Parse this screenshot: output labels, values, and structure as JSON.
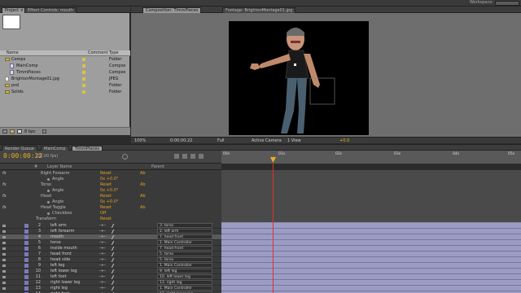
{
  "topbar": {
    "workspace_label": "Workspace:"
  },
  "project_panel": {
    "tabs": [
      "Project ×",
      "Effect Controls: mouth"
    ],
    "columns": {
      "name": "Name",
      "comment": "Comment",
      "type": "Type"
    },
    "items": [
      {
        "name": "Comps",
        "type": "Folder",
        "icon": "folder-icon"
      },
      {
        "name": "MainComp",
        "type": "Compos",
        "icon": "composition-icon"
      },
      {
        "name": "TimmPieces",
        "type": "Compos",
        "icon": "composition-icon"
      },
      {
        "name": "BrightonMontage01.jpg",
        "type": "JPEG",
        "icon": "image-icon"
      },
      {
        "name": "psd",
        "type": "Folder",
        "icon": "folder-icon"
      },
      {
        "name": "Solids",
        "type": "Folder",
        "icon": "folder-icon"
      }
    ],
    "bpc": "8 bpc"
  },
  "viewer": {
    "tabs": [
      "Composition: TimmPieces",
      "Footage: BrightonMontage01.jpg"
    ],
    "bar": {
      "zoom": "100%",
      "timecode": "0:00:00:22",
      "resolution": "Full",
      "camera": "Active Camera",
      "views": "1 View",
      "exposure": "+0.0"
    }
  },
  "timeline": {
    "tabs": [
      "Render Queue",
      "MainComp",
      "TimmPieces"
    ],
    "timecode": "0:00:00:22",
    "fps": "(25.00 fps)",
    "ruler_ticks": [
      "00s",
      "01s",
      "02s",
      "03s",
      "04s",
      "05s"
    ],
    "columns": {
      "layer_name": "Layer Name",
      "parent": "Parent"
    },
    "properties": [
      {
        "label": "Right Forearm",
        "v1": "Reset",
        "v2": "Ab",
        "fx": true
      },
      {
        "label": "Angle",
        "v1": "0x +0.0°",
        "v2": "",
        "fx": false
      },
      {
        "label": "Torso",
        "v1": "Reset",
        "v2": "Ab",
        "fx": true
      },
      {
        "label": "Angle",
        "v1": "0x +0.0°",
        "v2": "",
        "fx": false
      },
      {
        "label": "Head",
        "v1": "Reset",
        "v2": "Ab",
        "fx": true
      },
      {
        "label": "Angle",
        "v1": "0x +0.0°",
        "v2": "",
        "fx": false
      },
      {
        "label": "Head Toggle",
        "v1": "Reset",
        "v2": "Ab",
        "fx": true
      },
      {
        "label": "Checkbox",
        "v1": "Off",
        "v2": "",
        "fx": false
      },
      {
        "label": "Transform",
        "v1": "Reset",
        "v2": "",
        "fx": false
      }
    ],
    "layers": [
      {
        "num": "2",
        "name": "left arm",
        "parent": "3. torso",
        "selected": false
      },
      {
        "num": "3",
        "name": "left forearm",
        "parent": "2. left arm",
        "selected": false
      },
      {
        "num": "4",
        "name": "mouth",
        "parent": "7. head front",
        "selected": true
      },
      {
        "num": "5",
        "name": "torso",
        "parent": "1. Main Controller",
        "selected": false
      },
      {
        "num": "6",
        "name": "inside mouth",
        "parent": "7. head front",
        "selected": false
      },
      {
        "num": "7",
        "name": "head front",
        "parent": "5. torso",
        "selected": false
      },
      {
        "num": "8",
        "name": "head side",
        "parent": "5. torso",
        "selected": false
      },
      {
        "num": "9",
        "name": "left leg",
        "parent": "1. Main Controller",
        "selected": false
      },
      {
        "num": "10",
        "name": "left lower leg",
        "parent": "9. left leg",
        "selected": false
      },
      {
        "num": "11",
        "name": "left foot",
        "parent": "10. left lower leg",
        "selected": false
      },
      {
        "num": "12",
        "name": "right lower leg",
        "parent": "13. right leg",
        "selected": false
      },
      {
        "num": "13",
        "name": "right leg",
        "parent": "1. Main Controller",
        "selected": false
      },
      {
        "num": "14",
        "name": "right foot",
        "parent": "12. right lower leg",
        "selected": false
      }
    ]
  }
}
